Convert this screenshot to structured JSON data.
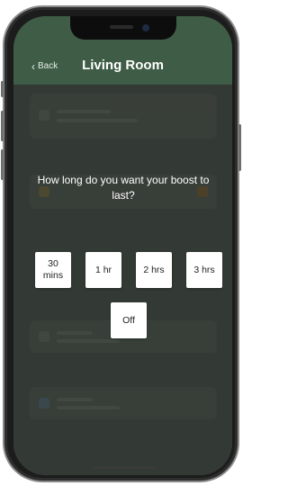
{
  "header": {
    "back_label": "Back",
    "title": "Living Room"
  },
  "dialog": {
    "question": "How long do you want your boost to last?",
    "options": [
      "30\nmins",
      "1 hr",
      "2 hrs",
      "3 hrs",
      "Off"
    ]
  },
  "colors": {
    "header_bg": "#3e5c46",
    "option_bg": "#ffffff",
    "overlay": "rgba(32,34,32,0.55)"
  },
  "icons": [
    "chevron-left-icon"
  ]
}
